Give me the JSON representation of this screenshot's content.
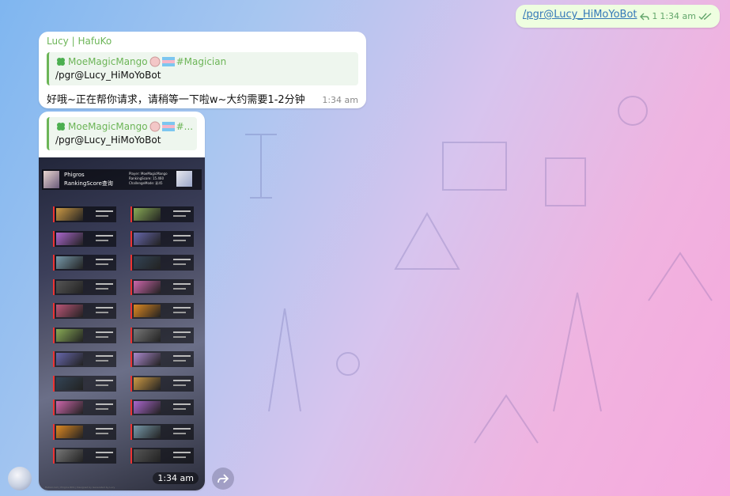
{
  "outgoing": {
    "command": "/pgr@Lucy_HiMoYoBot",
    "reply_count": "1",
    "time": "1:34 am"
  },
  "reply_message": {
    "sender": "Lucy | HafuKo",
    "quote_author": "MoeMagicMango",
    "quote_tag": "#Magician",
    "quote_text": "/pgr@Lucy_HiMoYoBot",
    "body": "好哦~正在帮你请求，请稍等一下啦w~大约需要1-2分钟",
    "time": "1:34 am"
  },
  "image_message": {
    "quote_author": "MoeMagicMango",
    "quote_tag": "#...",
    "quote_text": "/pgr@Lucy_HiMoYoBot",
    "time": "1:34 am",
    "image": {
      "header_title": "Phigros",
      "header_subtitle": "RankingScore查询",
      "player_line": "Player: MoeMagicMango",
      "rks_line": "RankingScore: 15.460",
      "challenge_line": "ChallengeMode: 彩45",
      "footer": "Hafuko bot | Phigros RKS | Designed by Generated by Lucy"
    }
  },
  "icons": {
    "quote_badge": "four-leaf-clover-icon",
    "reply_indicator": "reply-arrow-icon",
    "read_status": "double-check-icon",
    "forward": "forward-icon"
  },
  "colors": {
    "sender_green": "#6cb557",
    "link_blue": "#3578b8",
    "outgoing_bubble": "#eefee0"
  }
}
